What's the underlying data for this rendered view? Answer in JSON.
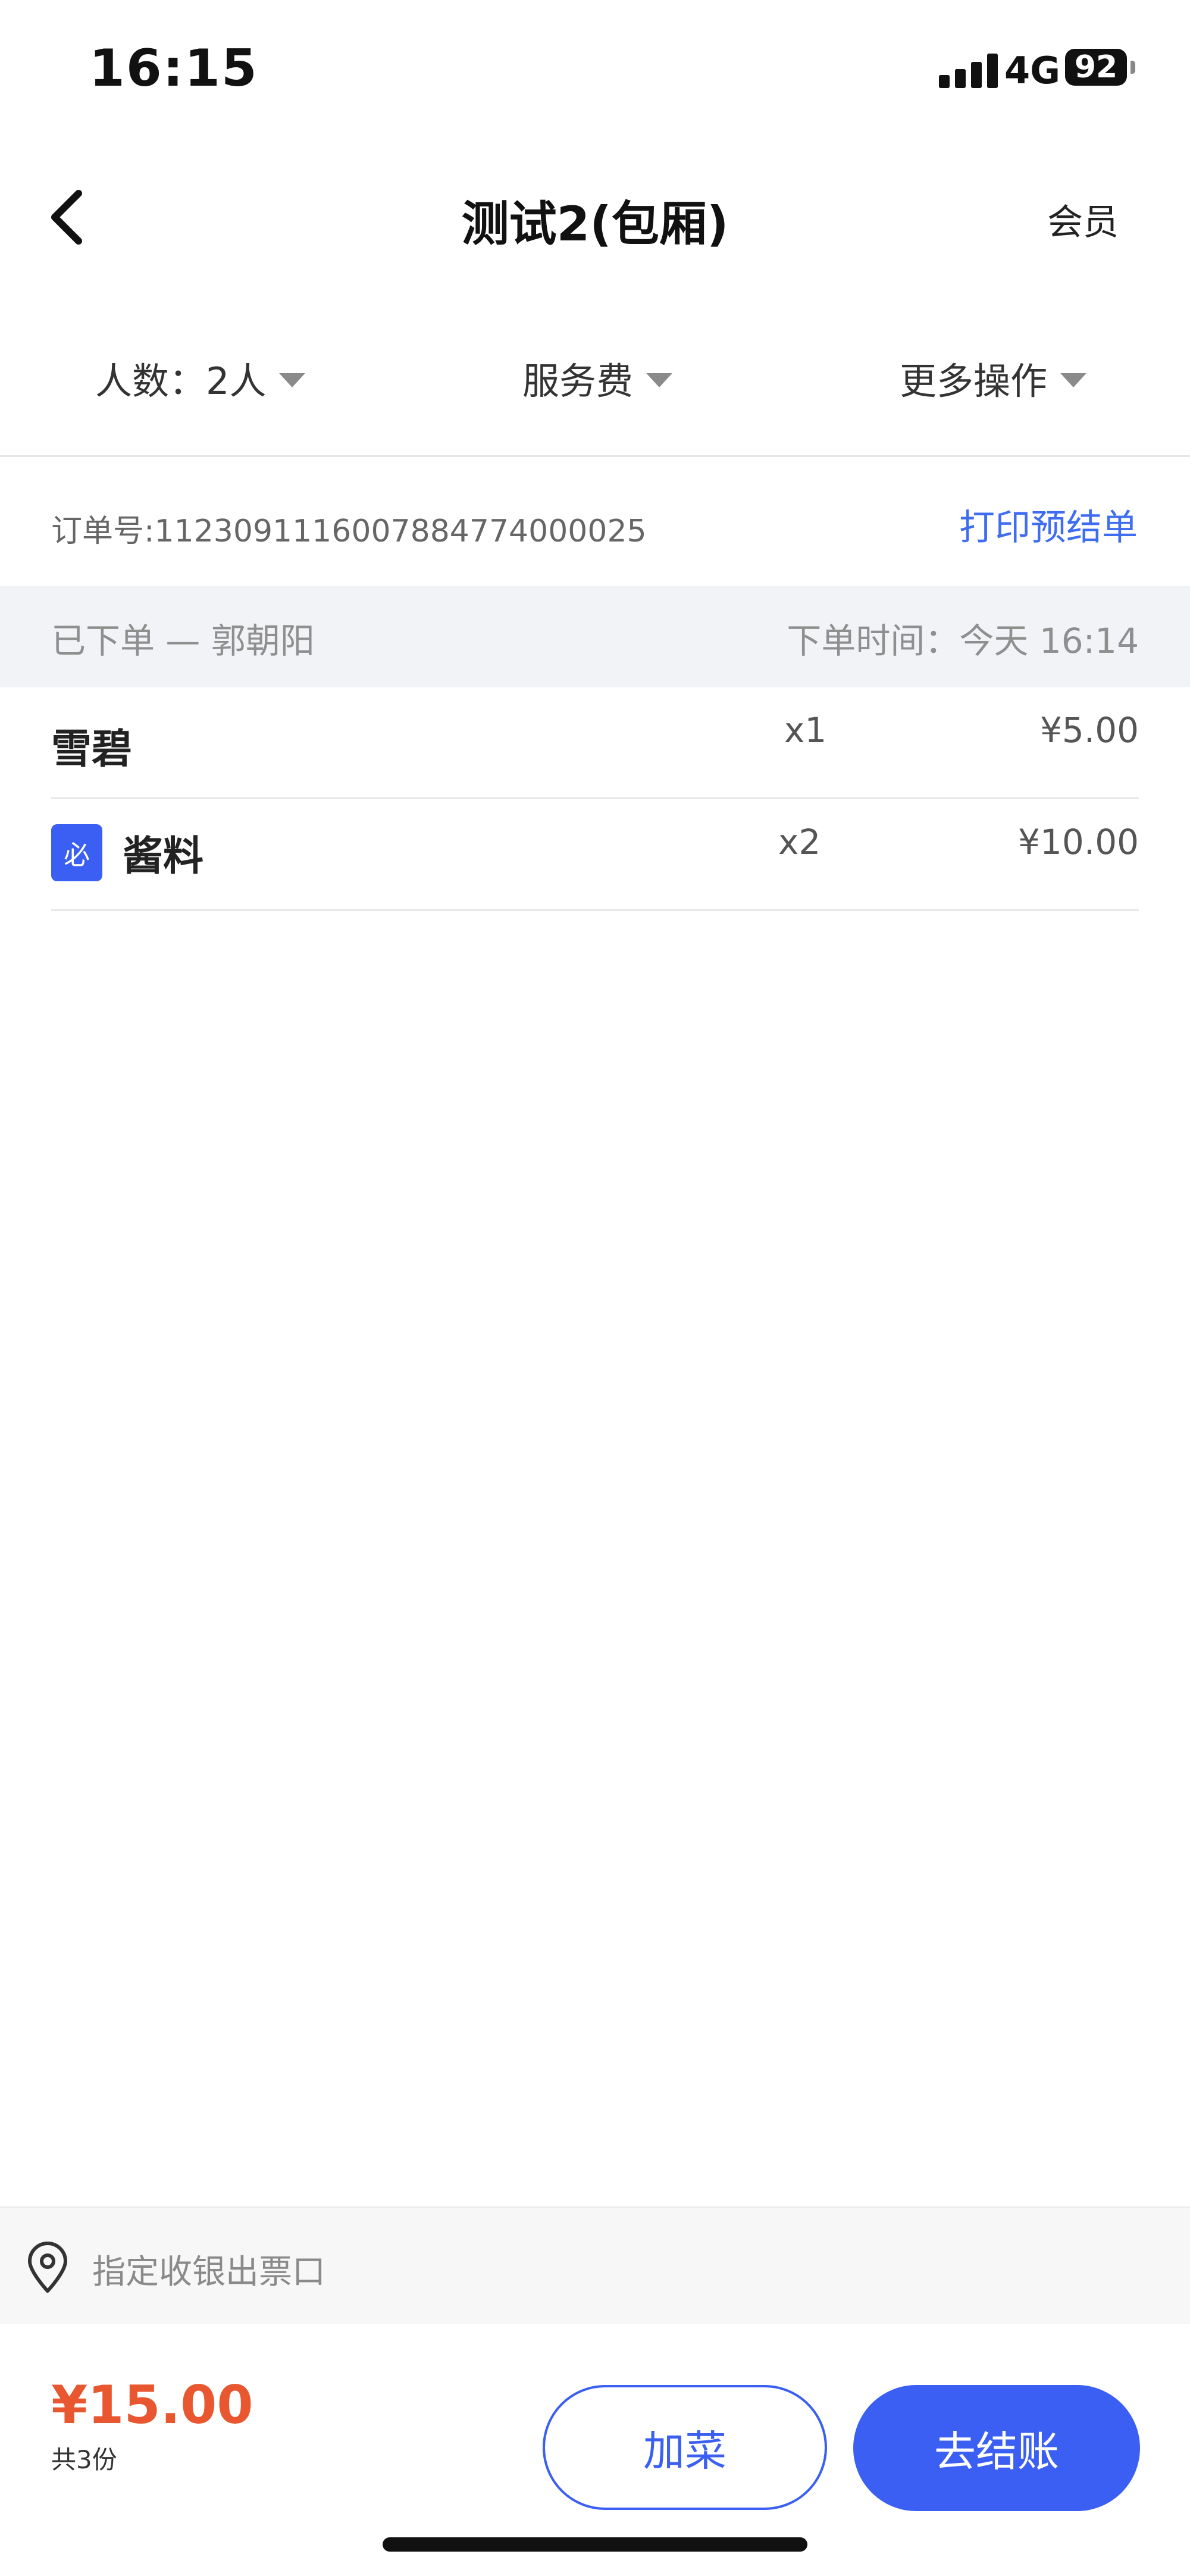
{
  "status_bar": {
    "time": "16:15",
    "network": "4G",
    "battery": "92"
  },
  "nav": {
    "back_icon": "chevron-left-icon",
    "title": "测试2(包厢)",
    "member_label": "会员"
  },
  "actions": {
    "people": "人数：2人",
    "service_fee": "服务费",
    "more": "更多操作"
  },
  "order": {
    "number_label": "订单号:1123091116007884774000025",
    "print_label": "打印预结单"
  },
  "group": {
    "status": "已下单 — 郭朝阳",
    "time": "下单时间：今天 16:14"
  },
  "items": [
    {
      "name": "雪碧",
      "qty": "x1",
      "price": "¥5.00",
      "badge": ""
    },
    {
      "name": "酱料",
      "qty": "x2",
      "price": "¥10.00",
      "badge": "必"
    }
  ],
  "ticket": {
    "icon": "location-pin-icon",
    "text": "指定收银出票口"
  },
  "footer": {
    "total": "¥15.00",
    "count": "共3份",
    "add_label": "加菜",
    "pay_label": "去结账"
  },
  "colors": {
    "accent": "#3b5ff2",
    "price_red": "#e8572f",
    "link_blue": "#3f6df0"
  }
}
